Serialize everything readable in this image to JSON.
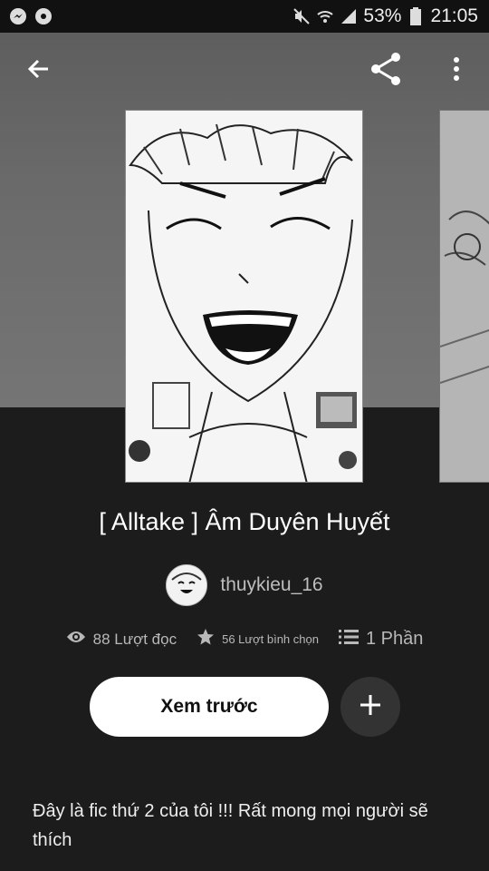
{
  "status_bar": {
    "battery": "53%",
    "time": "21:05",
    "left_icons": [
      "messenger-icon",
      "notification-icon"
    ],
    "right_icons": [
      "mute-icon",
      "wifi-icon",
      "signal-icon",
      "battery-icon"
    ]
  },
  "toolbar": {
    "back_icon": "arrow-left-icon",
    "share_icon": "share-icon",
    "more_icon": "more-vert-icon"
  },
  "story": {
    "title": "[ Alltake ] Âm Duyên Huyết",
    "author": "thuykieu_16",
    "reads": "88 Lượt đọc",
    "votes": "56 Lượt bình chọn",
    "parts": "1 Phần"
  },
  "actions": {
    "preview_label": "Xem trước"
  },
  "description": "Đây là fic thứ 2 của tôi !!! Rất mong mọi người sẽ thích"
}
